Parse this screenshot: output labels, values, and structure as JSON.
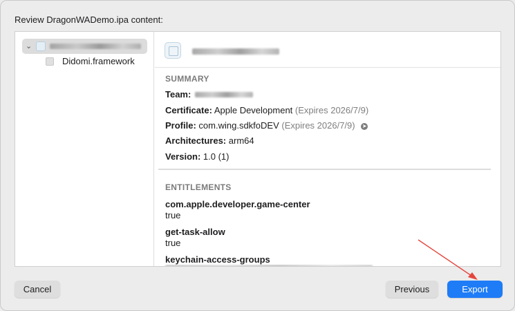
{
  "dialog": {
    "prompt": "Review DragonWADemo.ipa content:"
  },
  "sidebar": {
    "root_item_icon": "app-icon",
    "child_item": {
      "label": "Didomi.framework",
      "icon": "framework-icon"
    }
  },
  "summary": {
    "title": "SUMMARY",
    "team_label": "Team:",
    "certificate_label": "Certificate:",
    "certificate_value": "Apple Development",
    "certificate_expiry": "(Expires 2026/7/9)",
    "profile_label": "Profile:",
    "profile_value": "com.wing.sdkfoDEV",
    "profile_expiry": "(Expires 2026/7/9)",
    "architectures_label": "Architectures:",
    "architectures_value": "arm64",
    "version_label": "Version:",
    "version_value": "1.0 (1)"
  },
  "entitlements": {
    "title": "ENTITLEMENTS",
    "items": [
      {
        "key": "com.apple.developer.game-center",
        "value": "true"
      },
      {
        "key": "get-task-allow",
        "value": "true"
      },
      {
        "key": "keychain-access-groups",
        "value": ""
      }
    ]
  },
  "footer": {
    "cancel_label": "Cancel",
    "previous_label": "Previous",
    "export_label": "Export"
  },
  "colors": {
    "accent": "#1e7cf7",
    "annotation_arrow": "#e5453c"
  }
}
